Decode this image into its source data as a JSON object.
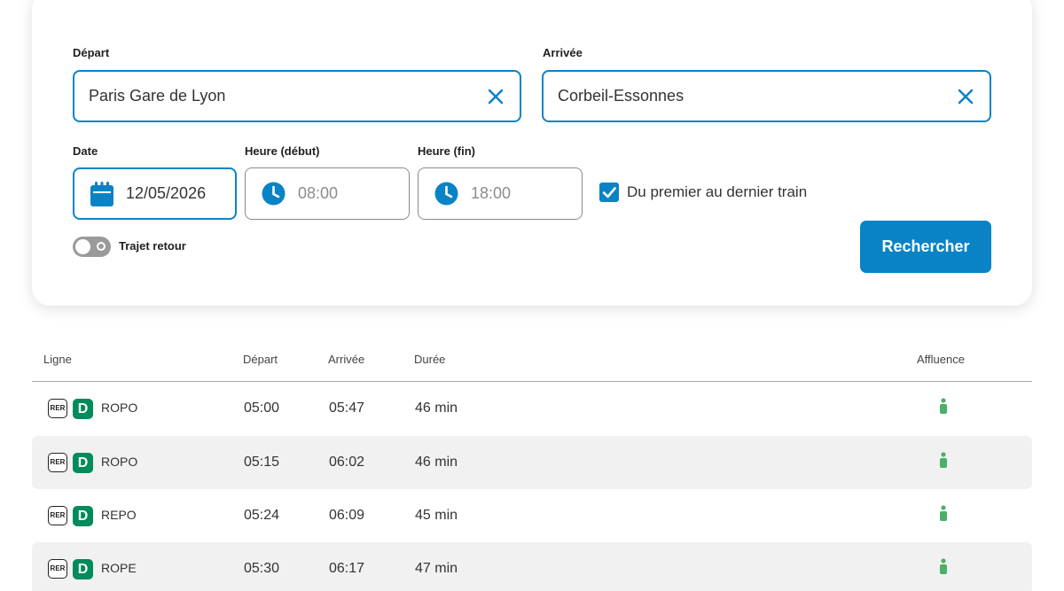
{
  "form": {
    "depart_label": "Départ",
    "depart_value": "Paris Gare de Lyon",
    "arrivee_label": "Arrivée",
    "arrivee_value": "Corbeil-Essonnes",
    "date_label": "Date",
    "date_value": "12/05/2026",
    "heure_debut_label": "Heure (début)",
    "heure_debut_placeholder": "08:00",
    "heure_fin_label": "Heure (fin)",
    "heure_fin_placeholder": "18:00",
    "premier_dernier_label": "Du premier au dernier train",
    "premier_dernier_checked": true,
    "trajet_retour_label": "Trajet retour",
    "trajet_retour_enabled": false,
    "search_label": "Rechercher"
  },
  "table": {
    "headers": {
      "ligne": "Ligne",
      "depart": "Départ",
      "arrivee": "Arrivée",
      "duree": "Durée",
      "affluence": "Affluence"
    },
    "rows": [
      {
        "network": "RER",
        "line": "D",
        "mission": "ROPO",
        "depart": "05:00",
        "arrivee": "05:47",
        "duree": "46 min",
        "affluence_icon": "person-icon"
      },
      {
        "network": "RER",
        "line": "D",
        "mission": "ROPO",
        "depart": "05:15",
        "arrivee": "06:02",
        "duree": "46 min",
        "affluence_icon": "person-icon"
      },
      {
        "network": "RER",
        "line": "D",
        "mission": "REPO",
        "depart": "05:24",
        "arrivee": "06:09",
        "duree": "45 min",
        "affluence_icon": "person-icon"
      },
      {
        "network": "RER",
        "line": "D",
        "mission": "ROPE",
        "depart": "05:30",
        "arrivee": "06:17",
        "duree": "47 min",
        "affluence_icon": "person-icon"
      }
    ]
  },
  "colors": {
    "accent": "#0a83c6",
    "line_d": "#008b5a",
    "affluence_low": "#4caf6a",
    "row_alt": "#f1f1f1"
  }
}
